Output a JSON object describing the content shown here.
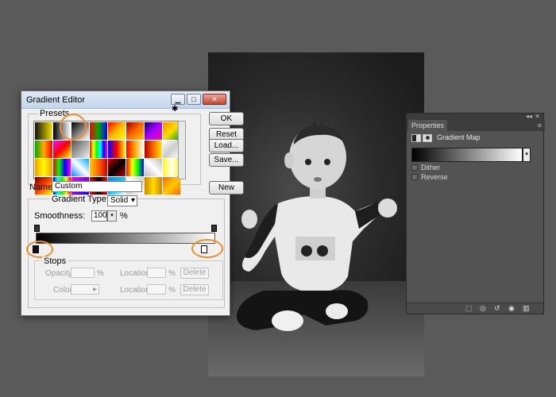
{
  "dialog": {
    "title": "Gradient Editor",
    "presets_label": "Presets",
    "buttons": {
      "ok": "OK",
      "reset": "Reset",
      "load": "Load...",
      "save": "Save...",
      "new": "New"
    },
    "name_label": "Name:",
    "name_value": "Custom",
    "gradient_type_label": "Gradient Type:",
    "gradient_type_value": "Solid",
    "smoothness_label": "Smoothness:",
    "smoothness_value": "100",
    "smoothness_unit": "%",
    "stops_label": "Stops",
    "opacity_label": "Opacity:",
    "opacity_unit": "%",
    "location_label": "Location:",
    "location_unit": "%",
    "color_label": "Color:",
    "delete_label": "Delete",
    "preset_swatches": [
      "linear-gradient(90deg,#111,#f5e100)",
      "linear-gradient(90deg,#000,#fff)",
      "linear-gradient(135deg,#000,#fff)",
      "linear-gradient(90deg,#f00,#0a0,#00f)",
      "linear-gradient(135deg,#f00,#fb0,#ff0)",
      "linear-gradient(135deg,#900,#f60,#fc0)",
      "linear-gradient(135deg,#006,#a0f,#f0a)",
      "linear-gradient(135deg,#f80,#fd0,#0a0)",
      "linear-gradient(90deg,#0a0,#fa0,#f00)",
      "linear-gradient(135deg,#f0f,#f00,#ff0)",
      "linear-gradient(135deg,#555,#eee)",
      "linear-gradient(90deg,#f00,#ff0,#0f0,#0ff,#00f,#f0f)",
      "linear-gradient(90deg,#00f,#f00,#ff0)",
      "linear-gradient(90deg,#f00,#fa0,#fff)",
      "linear-gradient(90deg,#a00,#f60,#fe0)",
      "linear-gradient(135deg,#fff,#ccc,#fff)",
      "linear-gradient(90deg,#f0a000,#ff0,#f0a000)",
      "linear-gradient(90deg,#f00,#0f0,#00f,#f0f)",
      "linear-gradient(45deg,#08f,#fff,#0af)",
      "linear-gradient(90deg,#fc0,#f60,#c00)",
      "linear-gradient(135deg,#c00,#000,#c00)",
      "linear-gradient(90deg,#f00,#ff0,#0f0,#00f)",
      "linear-gradient(45deg,#bbb,#fff,#bbb)",
      "linear-gradient(90deg,#ff0,#fff,#ff0)",
      "linear-gradient(135deg,#600,#f40,#ff0)",
      "linear-gradient(90deg,#00f,#0ff,#0f0,#ff0,#f00)",
      "linear-gradient(135deg,#f0f,#80f,#00f)",
      "linear-gradient(90deg,#f00,#000,#f00)",
      "linear-gradient(135deg,#08f,#0cf,#fff)",
      "linear-gradient(45deg,#ccc,#fff,#ccc)",
      "linear-gradient(90deg,#c80,#fd0,#c80)",
      "linear-gradient(135deg,#f60,#fc0,#f60)"
    ]
  },
  "properties": {
    "tab_label": "Properties",
    "collapse": "◂◂",
    "close": "✕",
    "menu": "≡",
    "title": "Gradient Map",
    "dither_label": "Dither",
    "reverse_label": "Reverse",
    "footer_icons": [
      "clip-to-layer",
      "view-previous",
      "reset",
      "visibility",
      "delete"
    ]
  },
  "icons": {
    "minimize": "▁",
    "maximize": "□",
    "close": "✕",
    "gear": "✱",
    "dropdown": "▾",
    "arrow_right": "▸"
  },
  "colors": {
    "highlight": "#f08c28"
  }
}
